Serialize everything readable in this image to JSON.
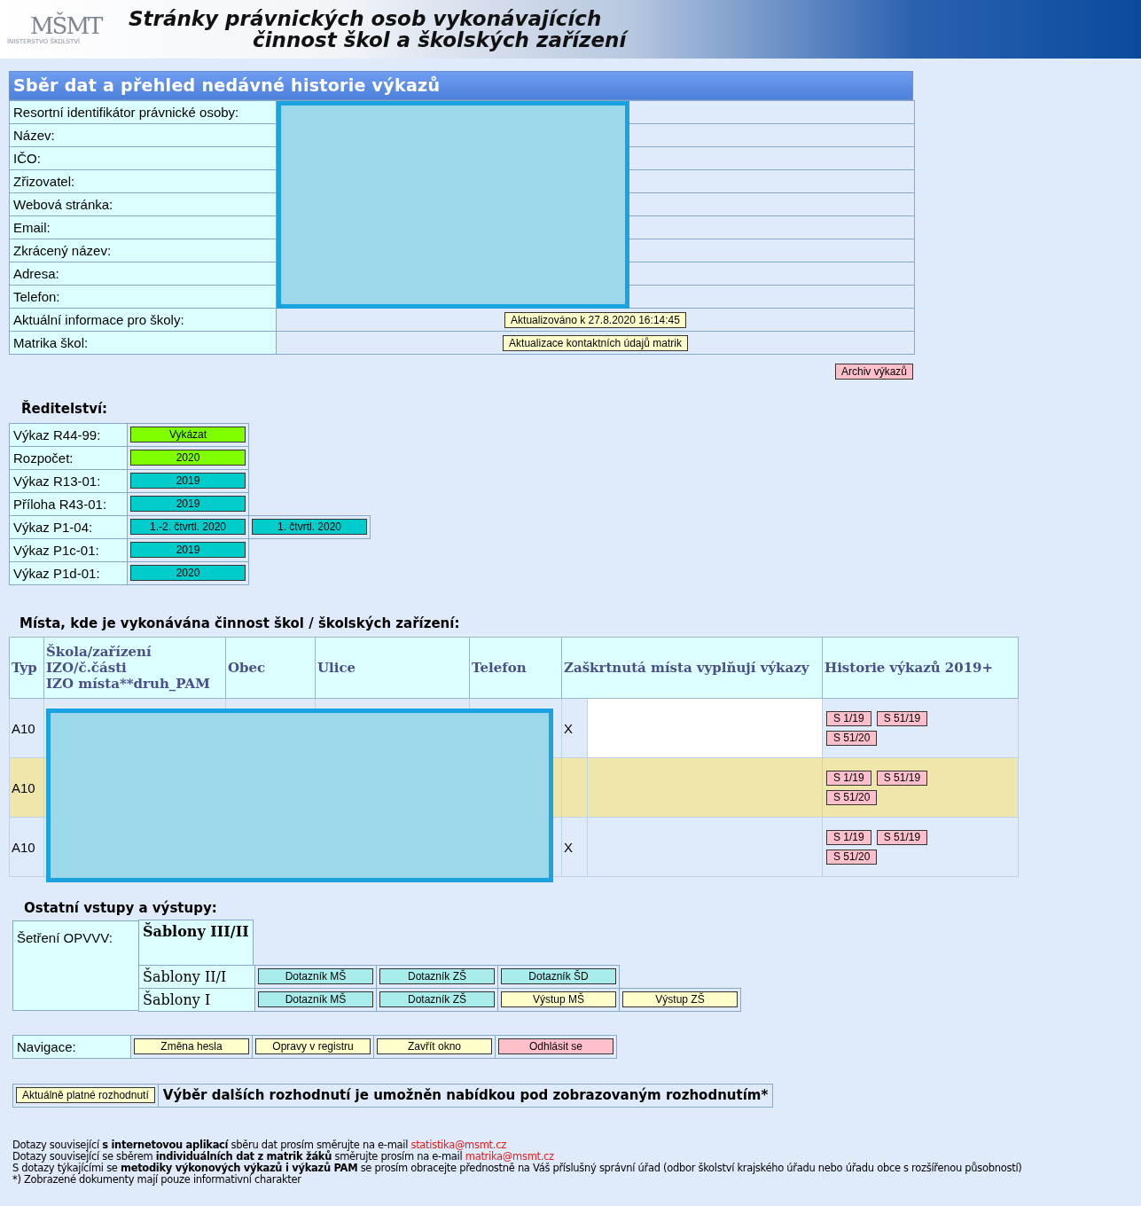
{
  "header": {
    "logo": "MŠMT",
    "logo_caption": "INISTERSTVO ŠKOLSTVÍ",
    "title_lines": [
      "Stránky právnických osob vykonávajících",
      "činnost škol a školských zařízení"
    ]
  },
  "overview": {
    "title": "Sběr dat a přehled nedávné historie výkazů",
    "rows": [
      {
        "label": "Resortní identifikátor právnické osoby:"
      },
      {
        "label": "Název:"
      },
      {
        "label": "IČO:"
      },
      {
        "label": "Zřizovatel:"
      },
      {
        "label": "Webová stránka:"
      },
      {
        "label": "Email:"
      },
      {
        "label": "Zkrácený název:"
      },
      {
        "label": "Adresa:"
      },
      {
        "label": "Telefon:"
      },
      {
        "label": "Aktuální informace pro školy:",
        "button": "Aktualizováno k 27.8.2020 16:14:45"
      },
      {
        "label": "Matrika škol:",
        "button": "Aktualizace kontaktních údajů matrik"
      }
    ],
    "archive_button": "Archiv výkazů"
  },
  "directorate": {
    "title": "Ředitelství:",
    "rows": [
      {
        "label": "Výkaz R44-99:",
        "buttons": [
          {
            "label": "Vykázat",
            "color": "#80ff00"
          }
        ]
      },
      {
        "label": "Rozpočet:",
        "buttons": [
          {
            "label": "2020",
            "color": "#80ff00"
          }
        ]
      },
      {
        "label": "Výkaz R13-01:",
        "buttons": [
          {
            "label": "2019",
            "color": "#00cccc"
          }
        ]
      },
      {
        "label": "Příloha R43-01:",
        "buttons": [
          {
            "label": "2019",
            "color": "#00cccc"
          }
        ]
      },
      {
        "label": "Výkaz P1-04:",
        "buttons": [
          {
            "label": "1.-2. čtvrtl. 2020",
            "color": "#00cccc"
          },
          {
            "label": "1. čtvrtl. 2020",
            "color": "#00cccc"
          }
        ]
      },
      {
        "label": "Výkaz P1c-01:",
        "buttons": [
          {
            "label": "2019",
            "color": "#00cccc"
          }
        ]
      },
      {
        "label": "Výkaz P1d-01:",
        "buttons": [
          {
            "label": "2020",
            "color": "#00cccc"
          }
        ]
      }
    ]
  },
  "places": {
    "title": "Místa, kde je vykonávána činnost škol / školských zařízení:",
    "columns": [
      {
        "lines": [
          "Typ"
        ]
      },
      {
        "lines": [
          "Škola/zařízení",
          "IZO/č.části",
          "IZO místa**druh_PAM"
        ]
      },
      {
        "lines": [
          "Obec"
        ]
      },
      {
        "lines": [
          "Ulice"
        ]
      },
      {
        "lines": [
          "Telefon"
        ]
      },
      {
        "lines": [
          "Zaškrtnutá místa vyplňují výkazy"
        ]
      },
      {
        "lines": [
          "Historie výkazů 2019+"
        ]
      }
    ],
    "rows": [
      {
        "type": "A10",
        "mark": "X",
        "highlighted": false,
        "history": [
          "S 1/19",
          "S 51/19",
          "S 51/20"
        ]
      },
      {
        "type": "A10",
        "highlighted": true,
        "history": [
          "S 1/19",
          "S 51/19",
          "S 51/20"
        ]
      },
      {
        "type": "A10",
        "mark": "X",
        "highlighted": false,
        "history": [
          "S 1/19",
          "S 51/19",
          "S 51/20"
        ]
      }
    ]
  },
  "other": {
    "title": "Ostatní vstupy a výstupy:",
    "group_label": "Šetření OPVVV:",
    "rows": [
      {
        "kind": "heading",
        "label": "Šablony III/II"
      },
      {
        "kind": "row",
        "label": "Šablony II/I",
        "buttons": [
          {
            "label": "Dotazník MŠ",
            "color": "#a8ecec"
          },
          {
            "label": "Dotazník ZŠ",
            "color": "#a8ecec"
          },
          {
            "label": "Dotazník ŠD",
            "color": "#a8ecec"
          }
        ]
      },
      {
        "kind": "row",
        "label": "Šablony I",
        "buttons": [
          {
            "label": "Dotazník MŠ",
            "color": "#a8ecec"
          },
          {
            "label": "Dotazník ZŠ",
            "color": "#a8ecec"
          },
          {
            "label": "Výstup MŠ",
            "color": "#ffffcc"
          },
          {
            "label": "Výstup ZŠ",
            "color": "#ffffcc"
          }
        ]
      }
    ]
  },
  "navigation": {
    "label": "Navigace:",
    "buttons": [
      {
        "label": "Změna hesla",
        "color": "#ffffcc"
      },
      {
        "label": "Opravy v registru",
        "color": "#ffffcc"
      },
      {
        "label": "Zavřít okno",
        "color": "#ffffcc"
      },
      {
        "label": "Odhlásit se",
        "color": "#ffc0cb"
      }
    ]
  },
  "decision": {
    "button": "Aktuálně platné rozhodnutí",
    "text": "Výběr dalších rozhodnutí je umožněn nabídkou pod zobrazovaným rozhodnutím*"
  },
  "footer": {
    "lines": [
      {
        "text": "Dotazy související **s internetovou aplikací** sběru dat prosím směrujte na e-mail",
        "link": "statistika@msmt.cz"
      },
      {
        "text": "Dotazy související se sběrem **individuálních dat z matrik žáků** směrujte prosím na e-mail",
        "link": "matrika@msmt.cz"
      },
      {
        "text": "S dotazy týkajícími se **metodiky výkonových výkazů i výkazů PAM** se prosím obracejte přednostně na Váš příslušný správní úřad (odbor školství krajského úřadu nebo úřadu obce s rozšířenou působností)"
      },
      {
        "text": "*) Zobrazené dokumenty mají pouze informativní charakter"
      }
    ]
  }
}
